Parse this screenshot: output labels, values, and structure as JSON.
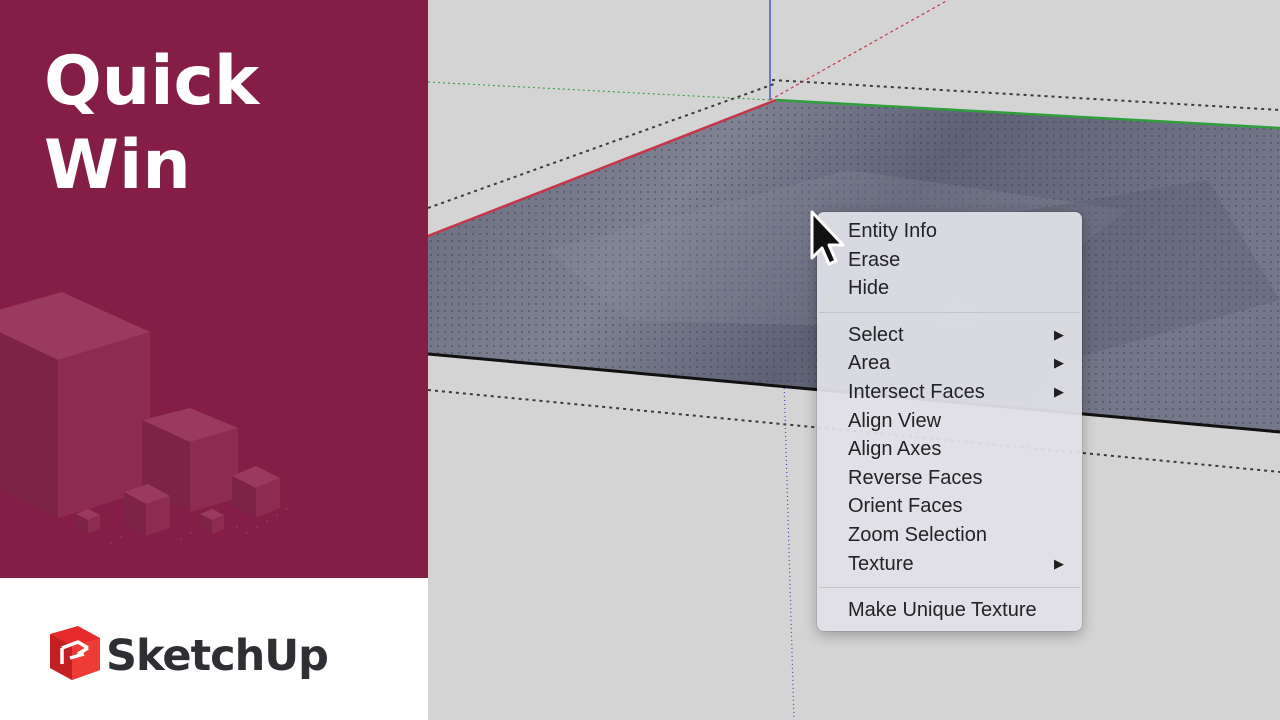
{
  "brand": {
    "title_line1": "Quick",
    "title_line2": "Win",
    "logo_text": "SketchUp",
    "panel_color": "#851e46",
    "logo_red": "#e72b2d",
    "logo_icon": "sketchup-logo-icon"
  },
  "viewport": {
    "axis_colors": {
      "red": "#c8344a",
      "green": "#2f9e3c",
      "blue": "#3a4fc8"
    },
    "cursor_icon": "arrow-cursor-icon"
  },
  "context_menu": {
    "group1": [
      {
        "label": "Entity Info",
        "has_submenu": false
      },
      {
        "label": "Erase",
        "has_submenu": false
      },
      {
        "label": "Hide",
        "has_submenu": false
      }
    ],
    "group2": [
      {
        "label": "Select",
        "has_submenu": true
      },
      {
        "label": "Area",
        "has_submenu": true
      },
      {
        "label": "Intersect Faces",
        "has_submenu": true
      },
      {
        "label": "Align View",
        "has_submenu": false
      },
      {
        "label": "Align Axes",
        "has_submenu": false
      },
      {
        "label": "Reverse Faces",
        "has_submenu": false
      },
      {
        "label": "Orient Faces",
        "has_submenu": false
      },
      {
        "label": "Zoom Selection",
        "has_submenu": false
      },
      {
        "label": "Texture",
        "has_submenu": true
      }
    ],
    "group3": [
      {
        "label": "Make Unique Texture",
        "has_submenu": false
      }
    ],
    "submenu_arrow": "▶"
  }
}
